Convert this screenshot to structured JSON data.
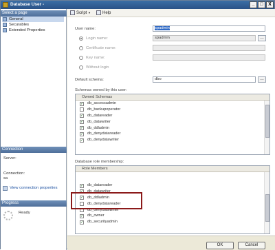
{
  "window": {
    "title": "Database User -",
    "buttons": [
      "_",
      "□",
      "X"
    ]
  },
  "left": {
    "select_header": "Select a page",
    "pages": [
      {
        "label": "General",
        "selected": true
      },
      {
        "label": "Securables"
      },
      {
        "label": "Extended Properties"
      }
    ],
    "connection_header": "Connection",
    "server_label": "Server:",
    "connection_label": "Connection:",
    "connection_value": "sa",
    "view_link": "View connection properties",
    "progress_header": "Progress",
    "progress_status": "Ready"
  },
  "toolbar": {
    "script": "Script",
    "help": "Help"
  },
  "form": {
    "user_name_label": "User name:",
    "user_name_value": "spadmin",
    "login_name_label": "Login name:",
    "login_name_value": "spadmin",
    "certificate_label": "Certificate name:",
    "key_label": "Key name:",
    "without_login_label": "Without login",
    "default_schema_label": "Default schema:",
    "default_schema_value": "dbo"
  },
  "schemas": {
    "title": "Schemas owned by this user:",
    "header": "Owned Schemas",
    "items": [
      {
        "label": "db_accessadmin",
        "checked": true
      },
      {
        "label": "db_backupoperator",
        "checked": false
      },
      {
        "label": "db_datareader",
        "checked": true
      },
      {
        "label": "db_datawriter",
        "checked": true
      },
      {
        "label": "db_ddladmin",
        "checked": true
      },
      {
        "label": "db_denydatareader",
        "checked": true
      },
      {
        "label": "db_denydatawriter",
        "checked": true
      }
    ]
  },
  "roles": {
    "title": "Database role membership:",
    "header": "Role Members",
    "items": [
      {
        "label": "db_datareader",
        "checked": true
      },
      {
        "label": "db_datawriter",
        "checked": true
      },
      {
        "label": "db_ddladmin",
        "checked": true
      },
      {
        "label": "db_denydatareader",
        "checked": false
      },
      {
        "label": "db_denydatawriter",
        "checked": false
      },
      {
        "label": "db_owner",
        "checked": true
      },
      {
        "label": "db_securityadmin",
        "checked": true
      }
    ]
  },
  "buttons": {
    "ok": "OK",
    "cancel": "Cancel"
  }
}
